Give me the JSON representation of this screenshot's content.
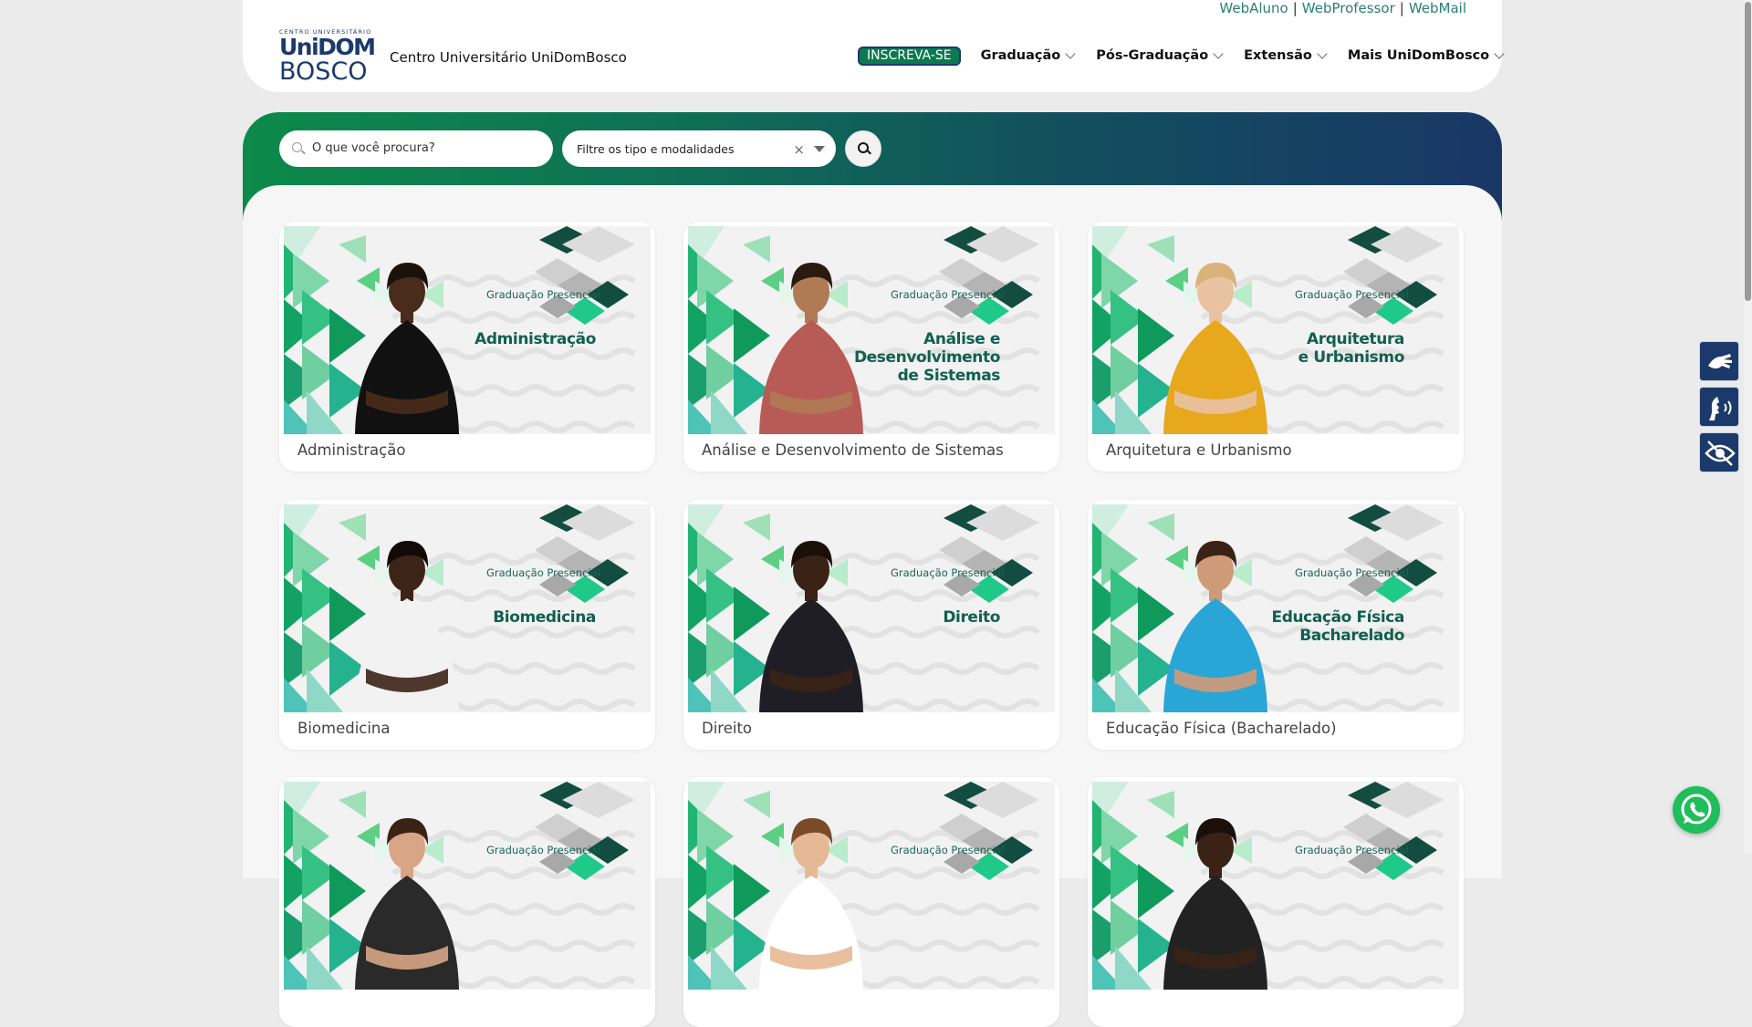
{
  "header": {
    "logo": {
      "top_text": "CENTRO UNIVERSITÁRIO",
      "line1_a": "Uni",
      "line1_b": "DOM",
      "line2": "BOSCO"
    },
    "site_title": "Centro Universitário UniDomBosco",
    "toplinks": [
      "WebAluno",
      "WebProfessor",
      "WebMail"
    ],
    "cta": "INSCREVA-SE",
    "nav": [
      "Graduação",
      "Pós-Graduação",
      "Extensão",
      "Mais UniDomBosco"
    ]
  },
  "search": {
    "placeholder": "O que você procura?",
    "filter_placeholder": "Filtre os tipo e modalidades",
    "clear_symbol": "×"
  },
  "courses": [
    {
      "label": "Administração",
      "kicker": "Graduação Presencial",
      "banner_title": "Administração",
      "person": {
        "skin": "#4a2c1c",
        "shirt": "#111111",
        "hair": "#1c120c"
      }
    },
    {
      "label": "Análise e Desenvolvimento de Sistemas",
      "kicker": "Graduação Presencial",
      "banner_title": "Análise e\nDesenvolvimento\nde Sistemas",
      "person": {
        "skin": "#b07a55",
        "shirt": "#b85a55",
        "hair": "#2a1a10"
      }
    },
    {
      "label": "Arquitetura e Urbanismo",
      "kicker": "Graduação Presencial",
      "banner_title": "Arquitetura\ne Urbanismo",
      "person": {
        "skin": "#e9c2a2",
        "shirt": "#e8a81e",
        "hair": "#d9b27a"
      }
    },
    {
      "label": "Biomedicina",
      "kicker": "Graduação Presencial",
      "banner_title": "Biomedicina",
      "person": {
        "skin": "#3c2418",
        "shirt": "#f2f2f2",
        "hair": "#120a06"
      }
    },
    {
      "label": "Direito",
      "kicker": "Graduação Presencial",
      "banner_title": "Direito",
      "person": {
        "skin": "#3a2216",
        "shirt": "#1e1e24",
        "hair": "#1a0f09"
      }
    },
    {
      "label": "Educação Física (Bacharelado)",
      "kicker": "Graduação Presencial",
      "banner_title": "Educação Física\nBacharelado",
      "person": {
        "skin": "#cf9a78",
        "shirt": "#2aa6d6",
        "hair": "#3a2314"
      }
    },
    {
      "label": "",
      "kicker": "Graduação Presencial",
      "banner_title": "",
      "person": {
        "skin": "#d8a585",
        "shirt": "#2a2a2a",
        "hair": "#3a2314"
      }
    },
    {
      "label": "",
      "kicker": "Graduação Presencial",
      "banner_title": "",
      "person": {
        "skin": "#e5b995",
        "shirt": "#ffffff",
        "hair": "#7a4a2a"
      }
    },
    {
      "label": "",
      "kicker": "Graduação Presencial",
      "banner_title": "",
      "person": {
        "skin": "#3a2216",
        "shirt": "#222222",
        "hair": "#1a0f09"
      }
    }
  ],
  "accessibility": [
    "sign-language-icon",
    "voice-reader-icon",
    "hide-visual-icon"
  ],
  "colors": {
    "brand_navy": "#1b3a6b",
    "brand_green": "#0c8a4a",
    "cta_green": "#0b7a4f",
    "link_teal": "#2a7f75",
    "whatsapp": "#1fbd5b"
  }
}
